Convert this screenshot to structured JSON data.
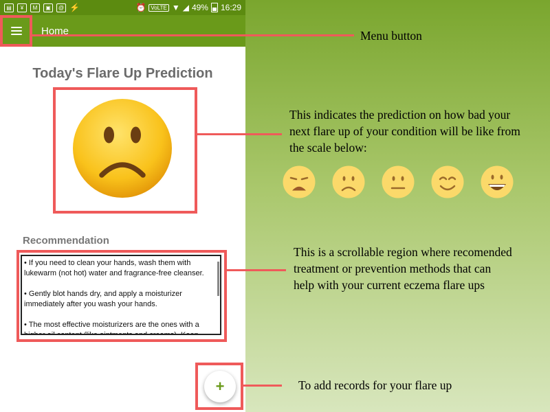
{
  "status_bar": {
    "volte": "VoLTE",
    "battery": "49%",
    "time": "16:29"
  },
  "app_bar": {
    "title": "Home"
  },
  "main": {
    "title": "Today's Flare Up Prediction",
    "prediction_icon": "frowning-face",
    "recommendation_label": "Recommendation",
    "recommendations": [
      "• If you need to clean your hands, wash them with lukewarm (not hot) water and fragrance-free cleanser.",
      "• Gently blot hands dry, and apply a moisturizer immediately after you wash your hands.",
      "• The most effective moisturizers are the ones with a higher oil content (like ointments and creams). Keep"
    ],
    "fab_label": "+"
  },
  "annotations": {
    "menu": "Menu button",
    "prediction": "This indicates the prediction on how bad your next flare up of your condition will be like from the scale below:",
    "recommendation": "This is a scrollable region where recomended treatment or prevention methods that can help with your current eczema flare ups",
    "add": "To add records for your flare up"
  },
  "scale_icons": [
    "weary-face",
    "frowning-face",
    "neutral-face",
    "smiling-face",
    "grinning-face"
  ],
  "colors": {
    "app_bar": "#6a9a1a",
    "status_bar": "#5c8b10",
    "highlight": "#ef5a5a",
    "accent": "#6a9a1a"
  }
}
